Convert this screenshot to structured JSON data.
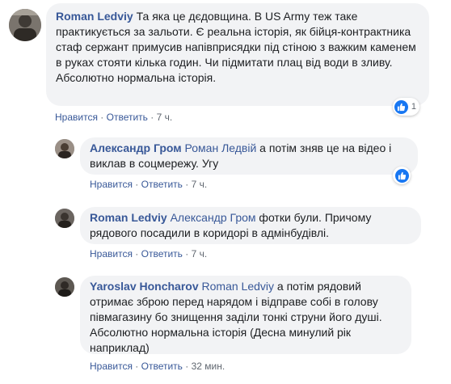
{
  "comments": [
    {
      "author": "Roman Ledviy",
      "mention": "",
      "text": "Та яка це дєдовщина. В US Army теж таке практикується за зальоти. Є реальна історія, як бійця-контрактника стаф сержант примусив напівприсядки під стіною з важким каменем в руках стояти кілька годин. Чи підмитати плац від води в зливу.",
      "text2": "Абсолютно нормальна історія.",
      "like_label": "Нравится",
      "reply_label": "Ответить",
      "time": "7 ч.",
      "reactions": "1"
    },
    {
      "author": "Александр Гром",
      "mention": "Роман Ледвій",
      "text": "а потім зняв це на відео і виклав в соцмережу. Угу",
      "like_label": "Нравится",
      "reply_label": "Ответить",
      "time": "7 ч.",
      "reactions": ""
    },
    {
      "author": "Roman Ledviy",
      "mention": "Александр Гром",
      "text": "фотки були. Причому рядового посадили в коридорі в адмінбудівлі.",
      "like_label": "Нравится",
      "reply_label": "Ответить",
      "time": "7 ч."
    },
    {
      "author": "Yaroslav Honcharov",
      "mention": "Roman Ledviy",
      "text": "а потім рядовий отримає зброю перед нарядом і відправе собі в голову півмагазину бо знищення заділи тонкі струни його душі. Абсолютно нормальна історія (Десна минулий рік наприклад)",
      "like_label": "Нравится",
      "reply_label": "Ответить",
      "time": "32 мин."
    }
  ],
  "separator": "·",
  "colors": {
    "link": "#385898",
    "bubble": "#f2f3f5",
    "like": "#1877f2",
    "meta": "#606770"
  },
  "icons": {
    "reaction": "like-icon"
  }
}
